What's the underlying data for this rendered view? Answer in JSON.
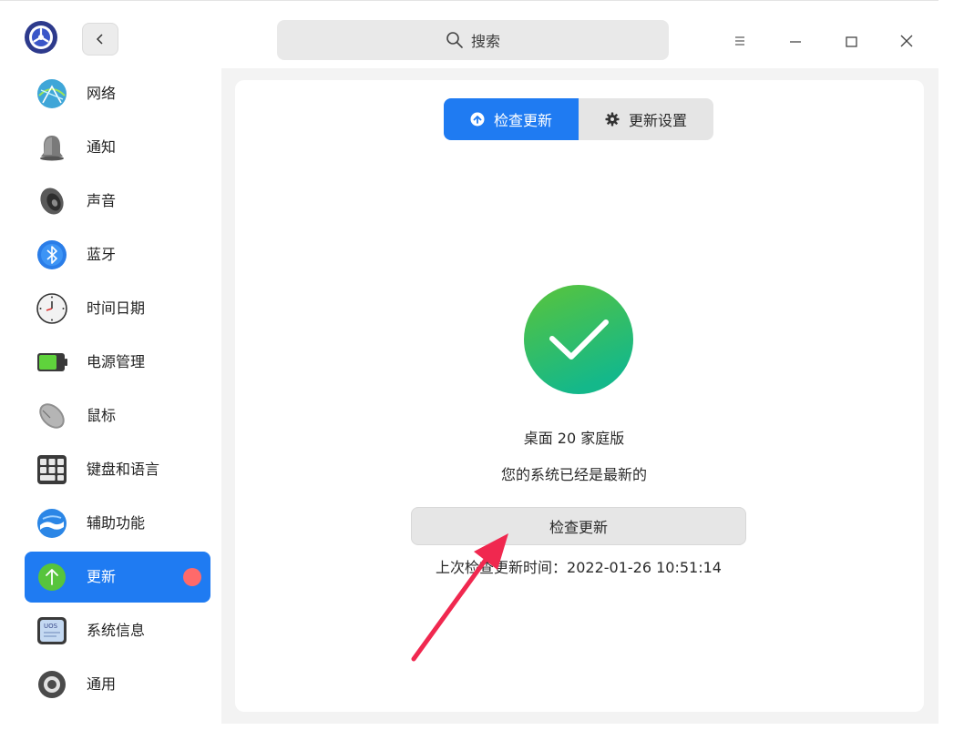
{
  "titlebar": {
    "search_placeholder": "搜索",
    "icons": [
      "settings-logo-icon",
      "back-chevron-icon",
      "search-icon",
      "menu-icon",
      "minimize-icon",
      "maximize-icon",
      "close-icon"
    ]
  },
  "sidebar": {
    "items": [
      {
        "label": "网络",
        "icon": "network-icon"
      },
      {
        "label": "通知",
        "icon": "bell-icon"
      },
      {
        "label": "声音",
        "icon": "speaker-icon"
      },
      {
        "label": "蓝牙",
        "icon": "bluetooth-icon"
      },
      {
        "label": "时间日期",
        "icon": "clock-icon"
      },
      {
        "label": "电源管理",
        "icon": "battery-icon"
      },
      {
        "label": "鼠标",
        "icon": "mouse-icon"
      },
      {
        "label": "键盘和语言",
        "icon": "keyboard-icon"
      },
      {
        "label": "辅助功能",
        "icon": "accessibility-icon"
      },
      {
        "label": "更新",
        "icon": "update-icon",
        "active": true,
        "badge": true
      },
      {
        "label": "系统信息",
        "icon": "system-info-icon",
        "icon_text": "UOS"
      },
      {
        "label": "通用",
        "icon": "general-gear-icon"
      }
    ]
  },
  "main": {
    "tabs": [
      {
        "label": "检查更新",
        "active": true
      },
      {
        "label": "更新设置",
        "active": false
      }
    ],
    "edition": "桌面 20 家庭版",
    "status": "您的系统已经是最新的",
    "check_button": "检查更新",
    "last_check": "上次检查更新时间：2022-01-26 10:51:14"
  },
  "colors": {
    "accent": "#1f7bf2",
    "badge": "#ff6a6a",
    "success_green": "#3cc05a",
    "annotation_arrow": "#f0284f"
  }
}
